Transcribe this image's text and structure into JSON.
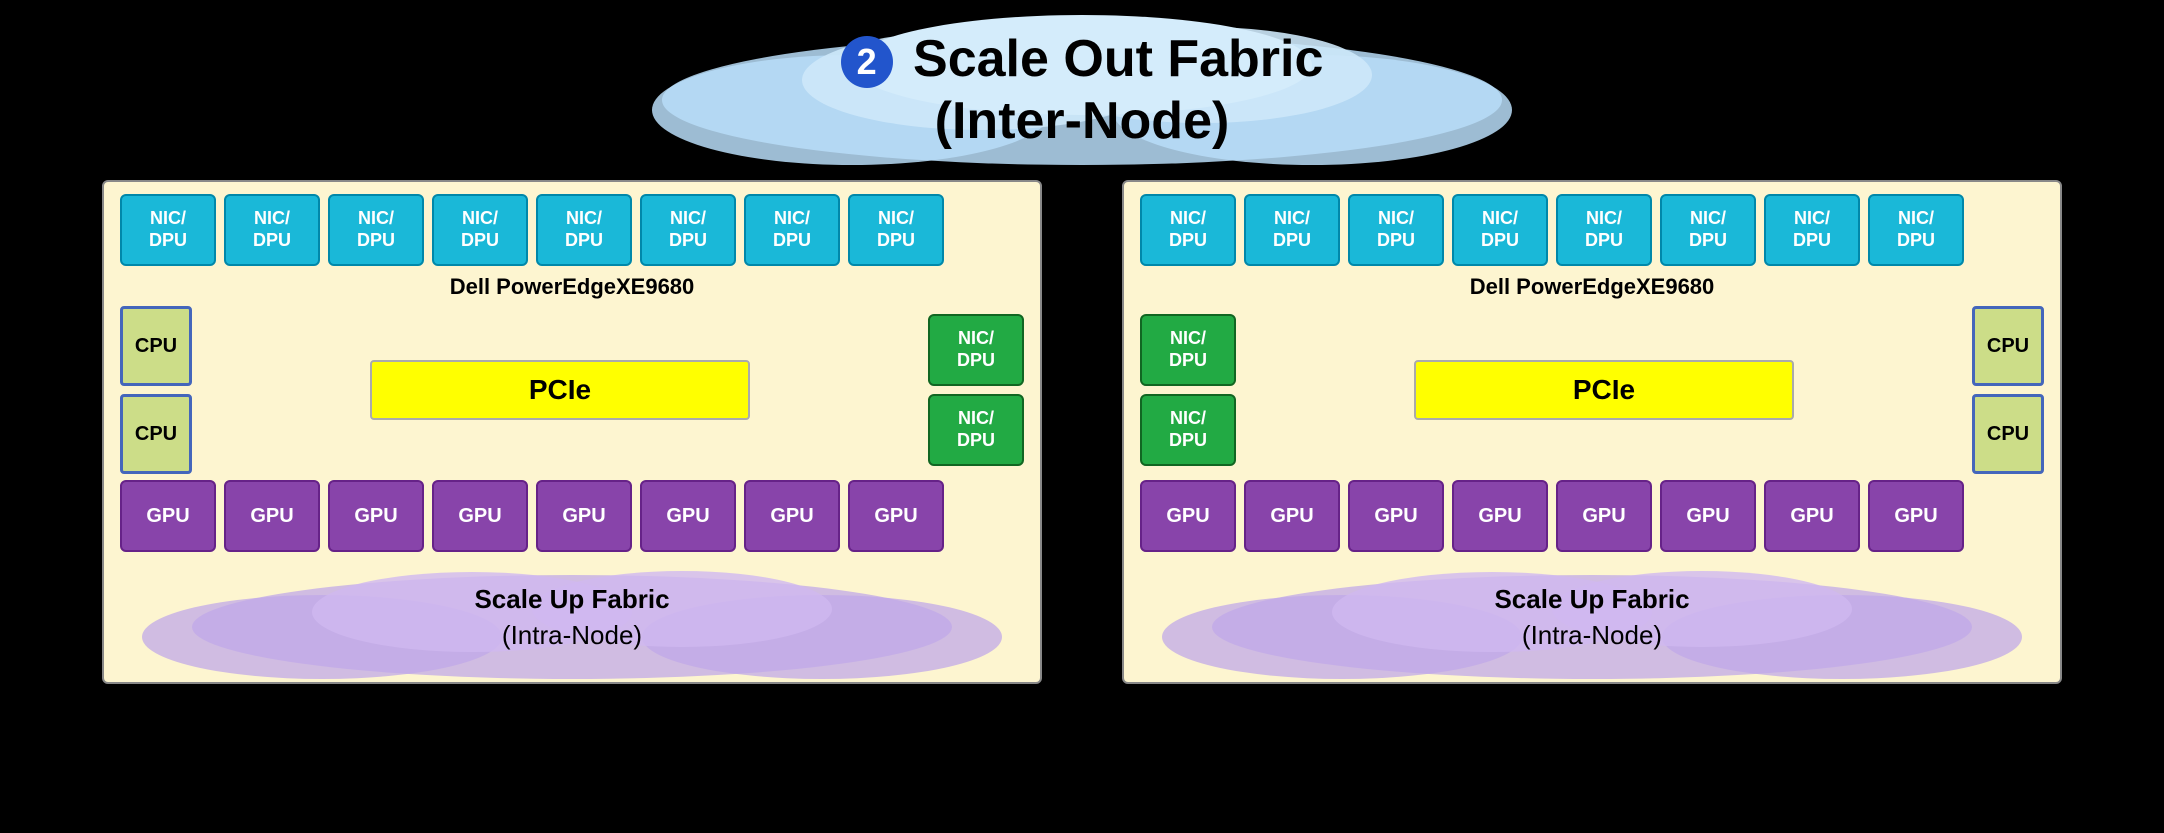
{
  "header": {
    "badge": "2",
    "title_line1": "Scale Out Fabric",
    "title_line2": "(Inter-Node)"
  },
  "node_left": {
    "server_name": "Dell PowerEdgeXE9680",
    "nic_top_count": 8,
    "nic_label": "NIC/\nDPU",
    "side_nic_labels": [
      "NIC/\nDPU",
      "NIC/\nDPU"
    ],
    "cpu_labels": [
      "CPU",
      "CPU"
    ],
    "pcie_label": "PCIe",
    "gpu_labels": [
      "GPU",
      "GPU",
      "GPU",
      "GPU",
      "GPU",
      "GPU",
      "GPU",
      "GPU"
    ],
    "scale_up_label": "Scale Up Fabric",
    "scale_up_sub": "(Intra-Node)"
  },
  "node_right": {
    "server_name": "Dell PowerEdgeXE9680",
    "nic_top_count": 8,
    "nic_label": "NIC/\nDPU",
    "side_nic_labels": [
      "NIC/\nDPU",
      "NIC/\nDPU"
    ],
    "cpu_labels": [
      "CPU",
      "CPU"
    ],
    "pcie_label": "PCIe",
    "gpu_labels": [
      "GPU",
      "GPU",
      "GPU",
      "GPU",
      "GPU",
      "GPU",
      "GPU",
      "GPU"
    ],
    "scale_up_label": "Scale Up Fabric",
    "scale_up_sub": "(Intra-Node)"
  }
}
